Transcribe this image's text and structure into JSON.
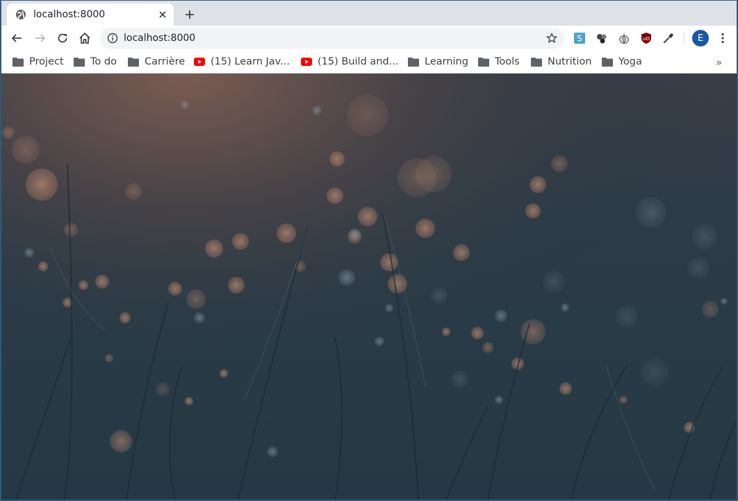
{
  "tab": {
    "title": "localhost:8000",
    "favicon": "globe-icon",
    "close_icon": "close-icon"
  },
  "new_tab": {
    "icon": "plus-icon"
  },
  "toolbar": {
    "back_icon": "back-arrow-icon",
    "forward_icon": "forward-arrow-icon",
    "reload_icon": "reload-icon",
    "home_icon": "home-icon"
  },
  "omnibox": {
    "url": "localhost:8000",
    "info_icon": "info-icon",
    "star_icon": "star-icon"
  },
  "extensions": [
    {
      "name": "s-extension-icon"
    },
    {
      "name": "circles-extension-icon"
    },
    {
      "name": "garlic-extension-icon"
    },
    {
      "name": "ublock-icon"
    },
    {
      "name": "eyedropper-icon"
    }
  ],
  "profile": {
    "initial": "E"
  },
  "bookmarks": [
    {
      "label": "Project",
      "icon": "folder-icon"
    },
    {
      "label": "To do",
      "icon": "folder-icon"
    },
    {
      "label": "Carrière",
      "icon": "folder-icon"
    },
    {
      "label": "(15) Learn Jav...",
      "icon": "youtube-icon"
    },
    {
      "label": "(15) Build and...",
      "icon": "youtube-icon"
    },
    {
      "label": "Learning",
      "icon": "folder-icon"
    },
    {
      "label": "Tools",
      "icon": "folder-icon"
    },
    {
      "label": "Nutrition",
      "icon": "folder-icon"
    },
    {
      "label": "Yoga",
      "icon": "folder-icon"
    }
  ],
  "bookmarks_more": "»",
  "colors": {
    "frame": "#dee1e6",
    "accent": "#1a56a8",
    "youtube": "#ff0000",
    "folder": "#5f6368"
  }
}
